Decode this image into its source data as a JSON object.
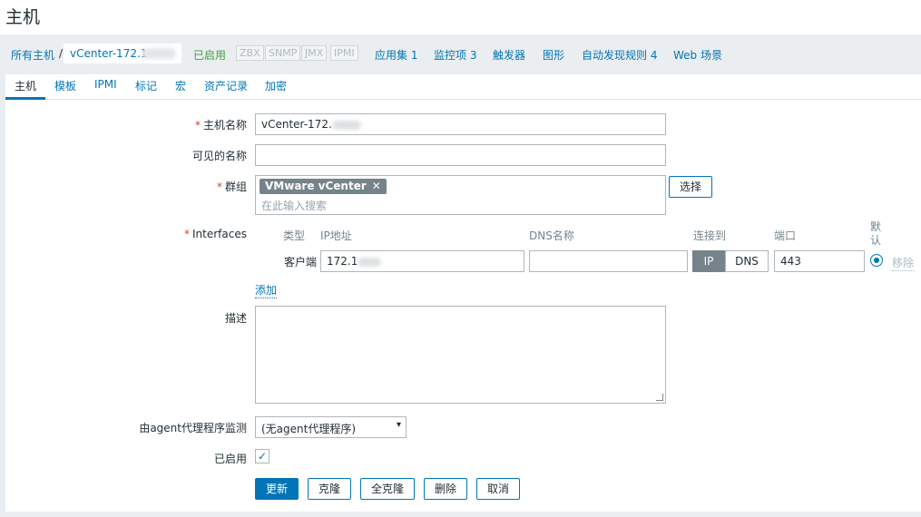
{
  "page_title": "主机",
  "breadcrumb": {
    "all_hosts": "所有主机",
    "separator": "/",
    "current_host": "vCenter-172.1"
  },
  "status": "已启用",
  "protocols": [
    "ZBX",
    "SNMP",
    "JMX",
    "IPMI"
  ],
  "nav_links": [
    "应用集 1",
    "监控项 3",
    "触发器",
    "图形",
    "自动发现规则 4",
    "Web 场景"
  ],
  "tabs": [
    "主机",
    "模板",
    "IPMI",
    "标记",
    "宏",
    "资产记录",
    "加密"
  ],
  "form": {
    "host_name_label": "主机名称",
    "host_name_value": "vCenter-172.",
    "visible_name_label": "可见的名称",
    "visible_name_value": "",
    "groups_label": "群组",
    "group_chip": "VMware vCenter",
    "group_search_placeholder": "在此输入搜索",
    "select_button": "选择",
    "interfaces_label": "Interfaces",
    "interface_headers": {
      "type": "类型",
      "ip": "IP地址",
      "dns": "DNS名称",
      "connect": "连接到",
      "port": "端口",
      "default": "默认"
    },
    "interface_row": {
      "type": "客户端",
      "ip": "172.1",
      "dns": "",
      "connect_ip": "IP",
      "connect_dns": "DNS",
      "port": "443",
      "remove": "移除"
    },
    "add_link": "添加",
    "description_label": "描述",
    "proxy_label": "由agent代理程序监测",
    "proxy_value": "(无agent代理程序)",
    "enabled_label": "已启用"
  },
  "buttons": {
    "update": "更新",
    "clone": "克隆",
    "full_clone": "全克隆",
    "delete": "删除",
    "cancel": "取消"
  },
  "colors": {
    "accent": "#0275b8",
    "enabled": "#429e47",
    "required": "#e33734"
  }
}
